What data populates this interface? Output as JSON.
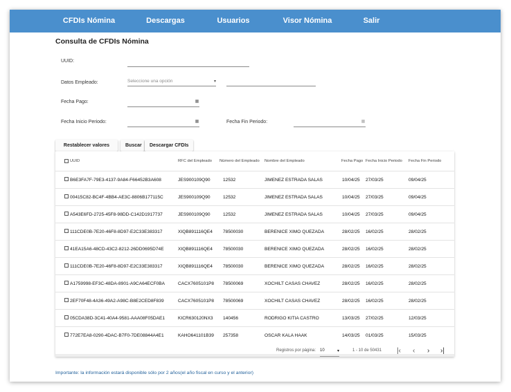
{
  "nav": {
    "items": [
      "CFDIs Nómina",
      "Descargas",
      "Usuarios",
      "Visor Nómina",
      "Salir"
    ]
  },
  "page": {
    "title": "Consulta de CFDIs Nómina"
  },
  "form": {
    "uuid_label": "UUID:",
    "empleado_label": "Datos Empleado:",
    "empleado_select_placeholder": "Seleccione una opción",
    "fecha_pago_label": "Fecha Pago:",
    "fecha_inicio_label": "Fecha Inicio Periodo:",
    "fecha_fin_label": "Fecha Fin Periodo:"
  },
  "buttons": {
    "reset": "Restablecer valores",
    "search": "Buscar",
    "download": "Descargar CFDIs"
  },
  "table": {
    "headers": [
      "UUID",
      "RFC del Empleado",
      "Número del Empleado",
      "Nombre del Empleado",
      "Fecha Pago",
      "Fecha Inicio Periodo",
      "Fecha Fin Periodo"
    ],
    "rows": [
      [
        "B6E3FA7F-79E3-4137-9A84-F66452B3A608",
        "JES900109Q90",
        "12532",
        "JIMENEZ ESTRADA SALAS",
        "10/04/25",
        "27/03/25",
        "09/04/25"
      ],
      [
        "00415C82-BC4F-4BB4-AE3C-8806B177115C",
        "JES900109Q90",
        "12532",
        "JIMENEZ ESTRADA SALAS",
        "10/04/25",
        "27/03/25",
        "09/04/25"
      ],
      [
        "A543E6FD-2725-45F8-98DD-C142D1917737",
        "JES900109Q90",
        "12532",
        "JIMENEZ ESTRADA SALAS",
        "10/04/25",
        "27/03/25",
        "09/04/25"
      ],
      [
        "111CDE0B-7E20-46F8-8D97-E2C33E383317",
        "XIQB891116QE4",
        "78500030",
        "BERENICE XIMO QUEZADA",
        "28/02/25",
        "16/02/25",
        "28/02/25"
      ],
      [
        "41EA15A6-48CD-43C2-8212-26DD0695D74E",
        "XIQB891116QE4",
        "78500030",
        "BERENICE XIMO QUEZADA",
        "28/02/25",
        "16/02/25",
        "28/02/25"
      ],
      [
        "111CDE0B-7E20-46F8-8D97-E2C33E383317",
        "XIQB891116QE4",
        "78500030",
        "BERENICE XIMO QUEZADA",
        "28/02/25",
        "16/02/25",
        "28/02/25"
      ],
      [
        "A1759998-EF3C-48DA-8901-A9CA64ECF0BA",
        "CACX7605101P8",
        "78500069",
        "XOCHILT CASAS CHAVEZ",
        "28/02/25",
        "16/02/25",
        "28/02/25"
      ],
      [
        "2EF70F48-4A36-49A2-A98C-B8E2CED8F839",
        "CACX7605101P8",
        "78500069",
        "XOCHILT CASAS CHAVEZ",
        "28/02/25",
        "16/02/25",
        "28/02/25"
      ],
      [
        "05CDA38D-3C41-40A4-9581-AAA08F05DAE1",
        "KICR630120NX3",
        "140456",
        "RODRIGO KITIA CASTRO",
        "13/03/25",
        "27/02/25",
        "12/03/25"
      ],
      [
        "772E7EA8-0290-4DAC-B7F0-7DE08844A4E1",
        "KAHO641101B39",
        "257358",
        "OSCAR KALA HAAK",
        "14/03/25",
        "01/03/25",
        "15/03/25"
      ]
    ]
  },
  "pagination": {
    "rows_per_page_label": "Registros por página:",
    "rows_per_page_value": "10",
    "range_text": "1 - 10 de 50431"
  },
  "footnote": "Importante: la información estará disponible sólo por 2 años(el año fiscal en curso y el anterior)",
  "colors": {
    "navbar": "#4a8fcd",
    "footnote": "#1f5f9a"
  }
}
